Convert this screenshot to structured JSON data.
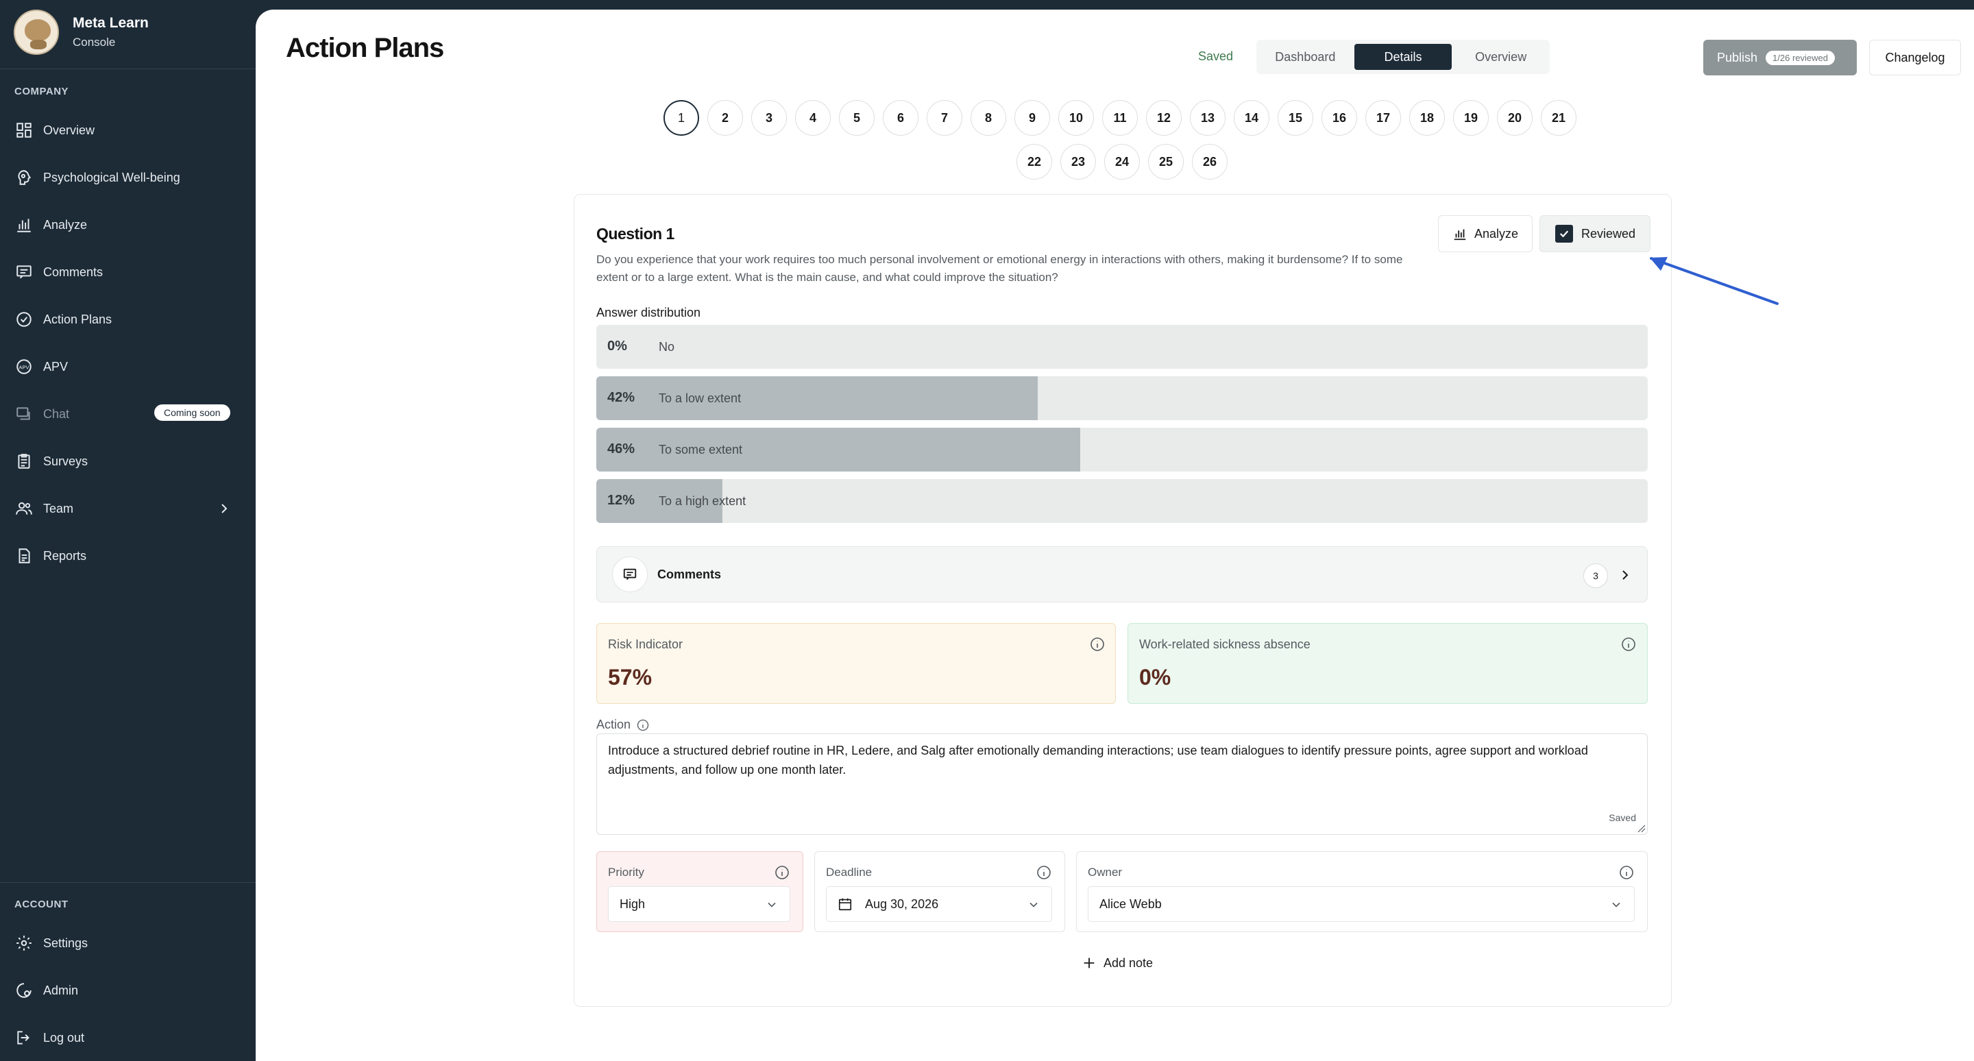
{
  "app": {
    "name": "Meta Learn",
    "subtitle": "Console"
  },
  "sidebar": {
    "company_label": "COMPANY",
    "items": [
      {
        "label": "Overview",
        "icon": "dashboard-icon"
      },
      {
        "label": "Psychological Well-being",
        "icon": "brain-icon"
      },
      {
        "label": "Analyze",
        "icon": "bar-chart-icon"
      },
      {
        "label": "Comments",
        "icon": "comment-icon"
      },
      {
        "label": "Action Plans",
        "icon": "check-circle-icon"
      },
      {
        "label": "APV",
        "icon": "apv-icon"
      },
      {
        "label": "Chat",
        "icon": "chat-icon",
        "badge": "Coming soon"
      },
      {
        "label": "Surveys",
        "icon": "clipboard-icon"
      },
      {
        "label": "Team",
        "icon": "users-icon"
      },
      {
        "label": "Reports",
        "icon": "document-icon"
      }
    ],
    "account_label": "ACCOUNT",
    "account_items": [
      {
        "label": "Settings",
        "icon": "gear-icon"
      },
      {
        "label": "Admin",
        "icon": "admin-icon"
      },
      {
        "label": "Log out",
        "icon": "logout-icon"
      }
    ]
  },
  "header": {
    "title": "Action Plans",
    "saved": "Saved",
    "tabs": [
      "Dashboard",
      "Details",
      "Overview"
    ],
    "active_tab": "Details",
    "publish": "Publish",
    "publish_pill": "1/26 reviewed",
    "changelog": "Changelog"
  },
  "pagination": {
    "pages": [
      "1",
      "2",
      "3",
      "4",
      "5",
      "6",
      "7",
      "8",
      "9",
      "10",
      "11",
      "12",
      "13",
      "14",
      "15",
      "16",
      "17",
      "18",
      "19",
      "20",
      "21",
      "22",
      "23",
      "24",
      "25",
      "26"
    ],
    "current": "1"
  },
  "question": {
    "title": "Question 1",
    "text": "Do you experience that your work requires too much personal involvement or emotional energy in interactions with others, making it burdensome? If to some extent or to a large extent. What is the main cause, and what could improve the situation?",
    "analyze": "Analyze",
    "reviewed": "Reviewed",
    "reviewed_checked": true,
    "distribution_label": "Answer distribution",
    "distribution": [
      {
        "pct_label": "0%",
        "label": "No",
        "value": 0
      },
      {
        "pct_label": "42%",
        "label": "To a low extent",
        "value": 42
      },
      {
        "pct_label": "46%",
        "label": "To some extent",
        "value": 46
      },
      {
        "pct_label": "12%",
        "label": "To a high extent",
        "value": 12
      }
    ],
    "comments_label": "Comments",
    "comments_count": "3",
    "risk_label": "Risk Indicator",
    "risk_value": "57%",
    "sickness_label": "Work-related sickness absence",
    "sickness_value": "0%",
    "action_label": "Action",
    "action_text": "Introduce a structured debrief routine in HR, Ledere, and Salg after emotionally demanding interactions; use team dialogues to identify pressure points, agree support and workload adjustments, and follow up one month later.",
    "action_saved": "Saved",
    "priority_label": "Priority",
    "priority_value": "High",
    "deadline_label": "Deadline",
    "deadline_value": "Aug 30, 2026",
    "owner_label": "Owner",
    "owner_value": "Alice Webb",
    "add_note": "Add note"
  },
  "colors": {
    "sidebar_bg": "#1d2b37",
    "accent": "#1d2b37",
    "bar_fill": "#b3babd",
    "risk_value": "#5d2a1e",
    "annotation_arrow": "#2f5fd0"
  }
}
